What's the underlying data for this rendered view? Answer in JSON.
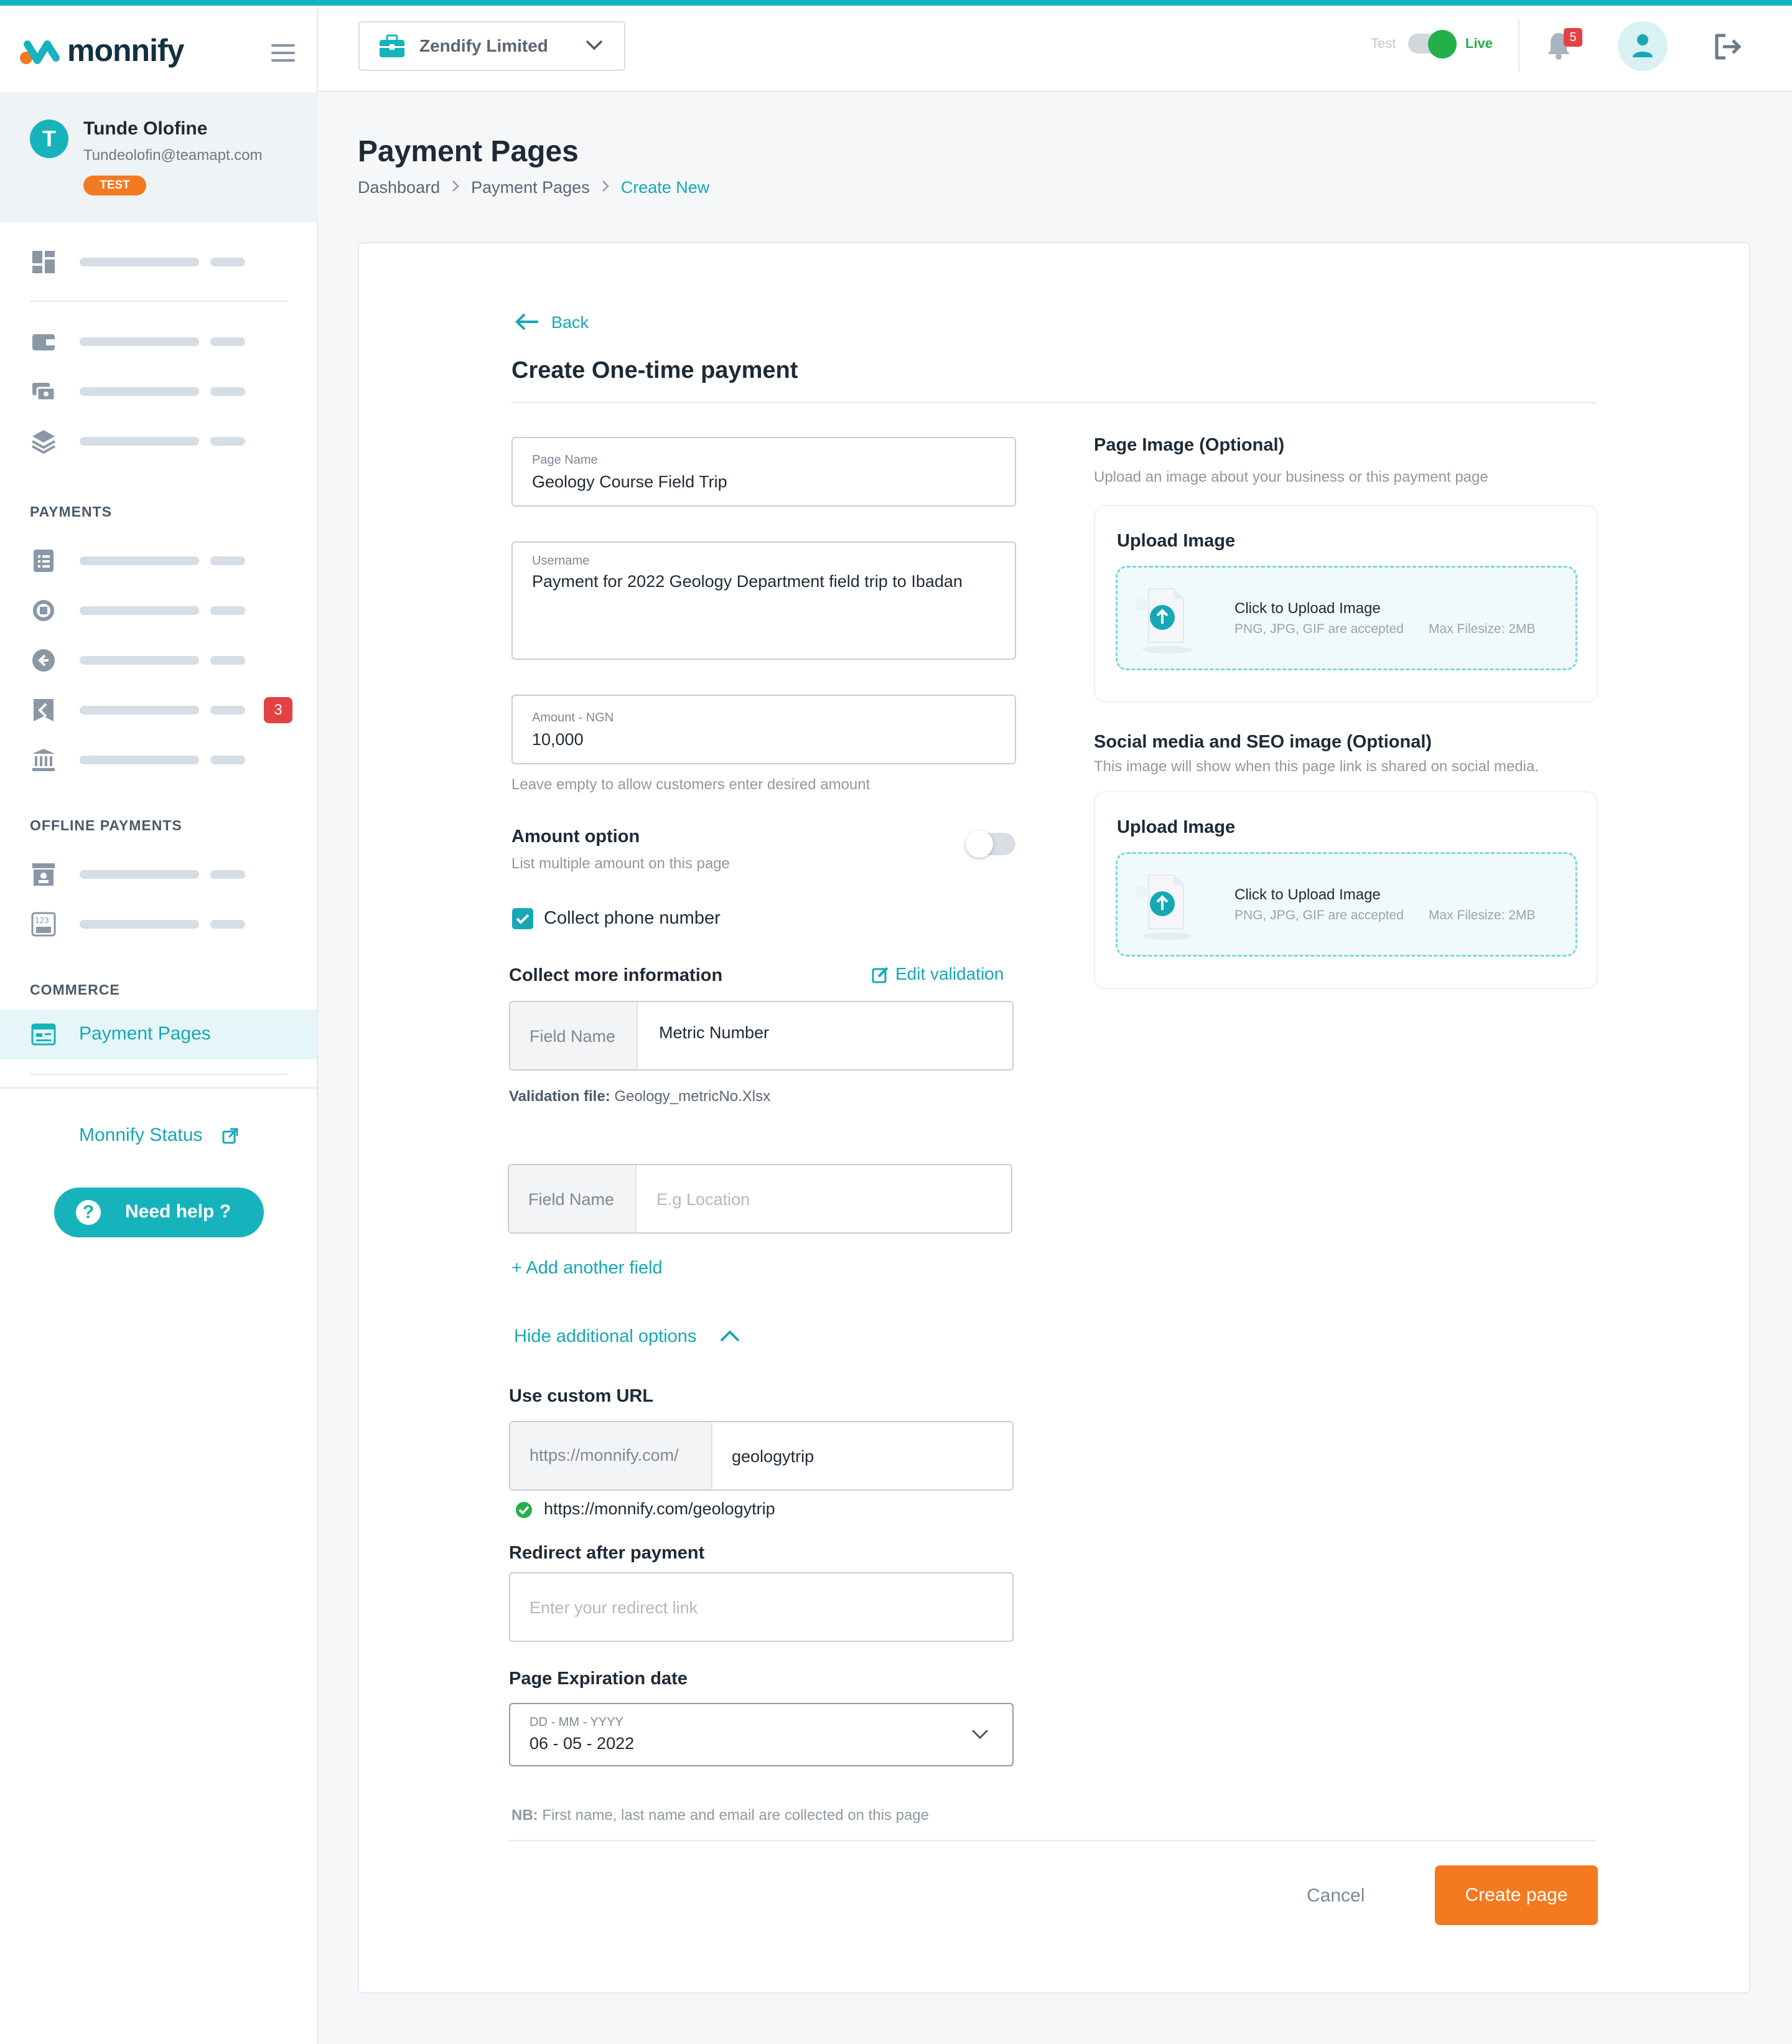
{
  "brand": {
    "name": "monnify"
  },
  "user": {
    "initial": "T",
    "name": "Tunde Olofine",
    "email": "Tundeolofin@teamapt.com",
    "env_tag": "TEST"
  },
  "sidebar": {
    "sections": {
      "payments": "PAYMENTS",
      "offline": "OFFLINE PAYMENTS",
      "commerce": "COMMERCE"
    },
    "badge_count": "3",
    "active_item": "Payment Pages",
    "status_link": "Monnify Status",
    "help_button": "Need help ?"
  },
  "topbar": {
    "business": "Zendify Limited",
    "mode_test": "Test",
    "mode_live": "Live",
    "notification_count": "5"
  },
  "page": {
    "title": "Payment Pages",
    "breadcrumb": [
      "Dashboard",
      "Payment Pages",
      "Create New"
    ]
  },
  "form": {
    "back": "Back",
    "heading": "Create One-time payment",
    "page_name": {
      "label": "Page Name",
      "value": "Geology Course Field Trip"
    },
    "username": {
      "label": "Username",
      "value": "Payment for 2022 Geology Department field trip to Ibadan"
    },
    "amount": {
      "label": "Amount - NGN",
      "value": "10,000",
      "hint": "Leave empty to allow customers enter desired amount"
    },
    "amount_option": {
      "title": "Amount option",
      "sub": "List multiple amount on this page"
    },
    "collect_phone": "Collect phone number",
    "collect_more": "Collect more information",
    "edit_validation": "Edit validation",
    "field1": {
      "prefix": "Field Name",
      "value": "Metric Number"
    },
    "validation_label": "Validation file:",
    "validation_file": "Geology_metricNo.Xlsx",
    "field2": {
      "prefix": "Field Name",
      "placeholder": "E.g Location"
    },
    "add_field": "Add another field",
    "hide_options": "Hide additional options",
    "custom_url": {
      "title": "Use custom URL",
      "prefix": "https://monnify.com/",
      "value": "geologytrip",
      "preview": "https://monnify.com/geologytrip"
    },
    "redirect": {
      "title": "Redirect after payment",
      "placeholder": "Enter your redirect link"
    },
    "expiry": {
      "title": "Page Expiration date",
      "label": "DD - MM - YYYY",
      "value": "06 - 05 - 2022"
    },
    "nb_label": "NB:",
    "nb_text": "First name, last name and email are collected on this page",
    "cancel": "Cancel",
    "submit": "Create page"
  },
  "images": {
    "page_image": {
      "title": "Page Image (Optional)",
      "sub": "Upload an image about your business or this payment page"
    },
    "seo_image": {
      "title": "Social media and SEO image (Optional)",
      "sub": "This image will show when this page link is shared on social media."
    },
    "upload": {
      "title": "Upload Image",
      "click": "Click to Upload Image",
      "accepted": "PNG, JPG, GIF are accepted",
      "max": "Max Filesize: 2MB"
    }
  },
  "colors": {
    "accent": "#16b3bd",
    "orange": "#f37a20",
    "badge": "#e34242",
    "live": "#22b04b"
  }
}
